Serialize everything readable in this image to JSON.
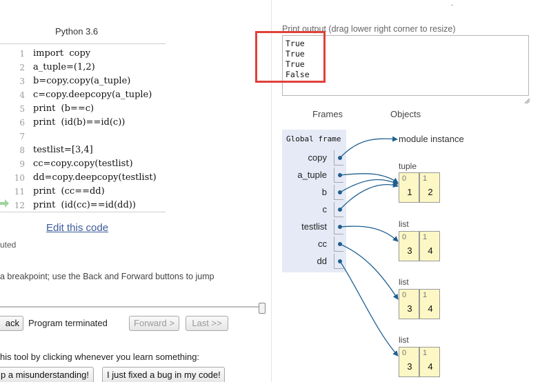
{
  "language_label": "Python 3.6",
  "code_lines": [
    {
      "num": "1",
      "text": "import  copy"
    },
    {
      "num": "2",
      "text": "a_tuple=(1,2)"
    },
    {
      "num": "3",
      "text": "b=copy.copy(a_tuple)"
    },
    {
      "num": "4",
      "text": "c=copy.deepcopy(a_tuple)"
    },
    {
      "num": "5",
      "text": "print  (b==c)"
    },
    {
      "num": "6",
      "text": "print  (id(b)==id(c))"
    },
    {
      "num": "7",
      "text": ""
    },
    {
      "num": "8",
      "text": "testlist=[3,4]"
    },
    {
      "num": "9",
      "text": "cc=copy.copy(testlist)"
    },
    {
      "num": "10",
      "text": "dd=copy.deepcopy(testlist)"
    },
    {
      "num": "11",
      "text": "print  (cc==dd)"
    },
    {
      "num": "12",
      "text": "print  (id(cc)==id(dd))"
    }
  ],
  "edit_link": "Edit this code",
  "exec_note": "uted",
  "breakpoint_note": "a breakpoint; use the Back and Forward buttons to jump",
  "controls": {
    "back_label": "ack",
    "status": "Program terminated",
    "forward_label": "Forward >",
    "last_label": "Last >>"
  },
  "feedback_note": "his tool by clicking whenever you learn something:",
  "feedback_buttons": {
    "misunderstanding": "p a misunderstanding!",
    "fixed_bug": "I just fixed a bug in my code!"
  },
  "print_output": {
    "label": "Print output (drag lower right corner to resize)",
    "lines": [
      "True",
      "True",
      "True",
      "False"
    ]
  },
  "visualizer": {
    "frames_header": "Frames",
    "objects_header": "Objects",
    "frame_title": "Global frame",
    "variables": [
      "copy",
      "a_tuple",
      "b",
      "c",
      "testlist",
      "cc",
      "dd"
    ],
    "module_label": "module instance",
    "objects": [
      {
        "type": "tuple",
        "items": [
          {
            "idx": "0",
            "val": "1"
          },
          {
            "idx": "1",
            "val": "2"
          }
        ]
      },
      {
        "type": "list",
        "items": [
          {
            "idx": "0",
            "val": "3"
          },
          {
            "idx": "1",
            "val": "4"
          }
        ]
      },
      {
        "type": "list",
        "items": [
          {
            "idx": "0",
            "val": "3"
          },
          {
            "idx": "1",
            "val": "4"
          }
        ]
      },
      {
        "type": "list",
        "items": [
          {
            "idx": "0",
            "val": "3"
          },
          {
            "idx": "1",
            "val": "4"
          }
        ]
      }
    ]
  },
  "colors": {
    "highlight_box": "#e0403a",
    "arrow": "#1f5f8f",
    "frame_bg": "#e5eaf6",
    "cell_bg": "#fcf7c4",
    "link": "#3b5a9a",
    "current_line_arrow": "#9ed49a"
  }
}
